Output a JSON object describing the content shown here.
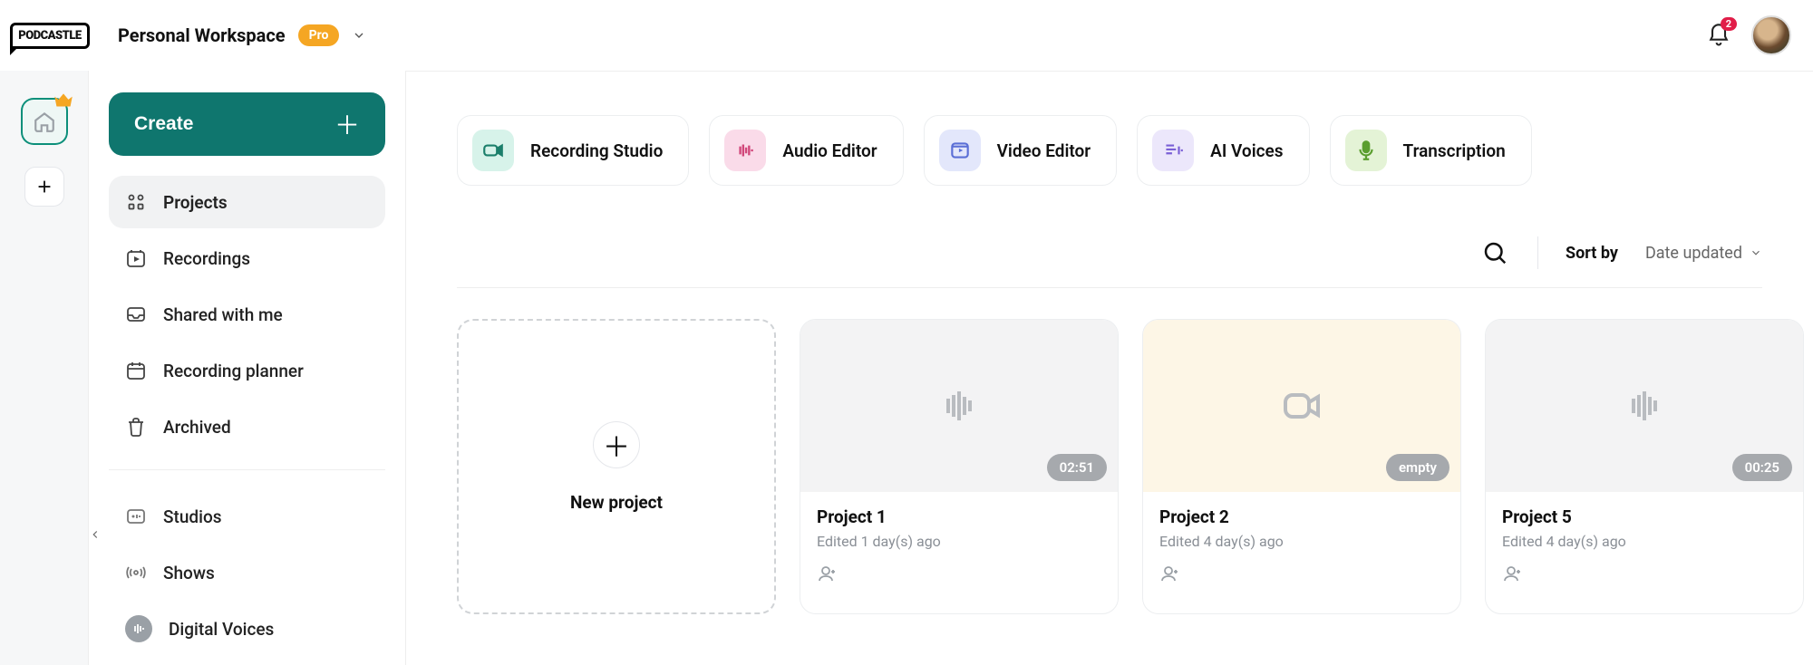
{
  "brand": "PODCASTLE",
  "workspace": {
    "name": "Personal Workspace",
    "plan": "Pro"
  },
  "notifications": {
    "count": "2"
  },
  "sidebar": {
    "create_label": "Create",
    "nav": [
      {
        "id": "projects",
        "label": "Projects"
      },
      {
        "id": "recordings",
        "label": "Recordings"
      },
      {
        "id": "shared",
        "label": "Shared with me"
      },
      {
        "id": "planner",
        "label": "Recording planner"
      },
      {
        "id": "archived",
        "label": "Archived"
      }
    ],
    "nav2": [
      {
        "id": "studios",
        "label": "Studios"
      },
      {
        "id": "shows",
        "label": "Shows"
      },
      {
        "id": "voices",
        "label": "Digital Voices"
      }
    ]
  },
  "tools": [
    {
      "id": "recording",
      "label": "Recording Studio"
    },
    {
      "id": "audio",
      "label": "Audio Editor"
    },
    {
      "id": "video",
      "label": "Video Editor"
    },
    {
      "id": "ai",
      "label": "AI Voices"
    },
    {
      "id": "transcription",
      "label": "Transcription"
    }
  ],
  "sort": {
    "label": "Sort by",
    "value": "Date updated"
  },
  "new_project_label": "New project",
  "projects": [
    {
      "title": "Project 1",
      "subtitle": "Edited 1 day(s) ago",
      "badge": "02:51",
      "kind": "audio"
    },
    {
      "title": "Project 2",
      "subtitle": "Edited 4 day(s) ago",
      "badge": "empty",
      "kind": "video"
    },
    {
      "title": "Project 5",
      "subtitle": "Edited 4 day(s) ago",
      "badge": "00:25",
      "kind": "audio"
    }
  ]
}
